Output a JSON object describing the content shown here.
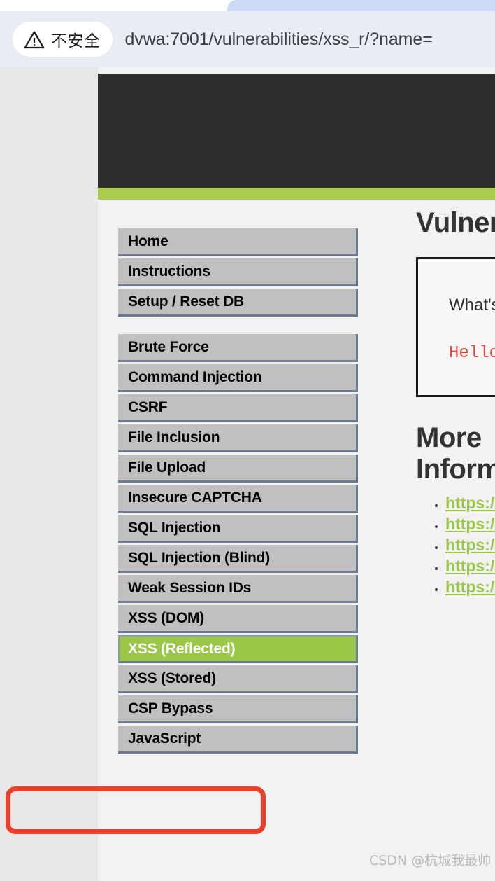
{
  "browser": {
    "tab": {
      "name": "browser-tab"
    },
    "security_chip": {
      "icon": "warning-triangle-icon",
      "label": "不安全"
    },
    "url": "dvwa:7001/vulnerabilities/xss_r/?name="
  },
  "sidebar": {
    "groups": [
      {
        "items": [
          {
            "label": "Home",
            "selected": false
          },
          {
            "label": "Instructions",
            "selected": false
          },
          {
            "label": "Setup / Reset DB",
            "selected": false
          }
        ]
      },
      {
        "items": [
          {
            "label": "Brute Force",
            "selected": false
          },
          {
            "label": "Command Injection",
            "selected": false
          },
          {
            "label": "CSRF",
            "selected": false
          },
          {
            "label": "File Inclusion",
            "selected": false
          },
          {
            "label": "File Upload",
            "selected": false
          },
          {
            "label": "Insecure CAPTCHA",
            "selected": false
          },
          {
            "label": "SQL Injection",
            "selected": false
          },
          {
            "label": "SQL Injection (Blind)",
            "selected": false
          },
          {
            "label": "Weak Session IDs",
            "selected": false
          },
          {
            "label": "XSS (DOM)",
            "selected": false
          },
          {
            "label": "XSS (Reflected)",
            "selected": true
          },
          {
            "label": "XSS (Stored)",
            "selected": false
          },
          {
            "label": "CSP Bypass",
            "selected": false
          },
          {
            "label": "JavaScript",
            "selected": false
          }
        ]
      }
    ]
  },
  "content": {
    "heading": "Vulnerability:",
    "panel": {
      "question": "What's your name?",
      "greeting": "Hello"
    },
    "more_heading": "More Information",
    "more_links": [
      "https://",
      "https://",
      "https://",
      "https://",
      "https://"
    ]
  },
  "watermark": "CSDN @杭城我最帅",
  "colors": {
    "accent_green": "#9ac747",
    "header_dark": "#2e2e2e",
    "annotation_red": "#e8402a",
    "menu_gray": "#c0c0c0",
    "page_bg": "#f2f2f2"
  }
}
